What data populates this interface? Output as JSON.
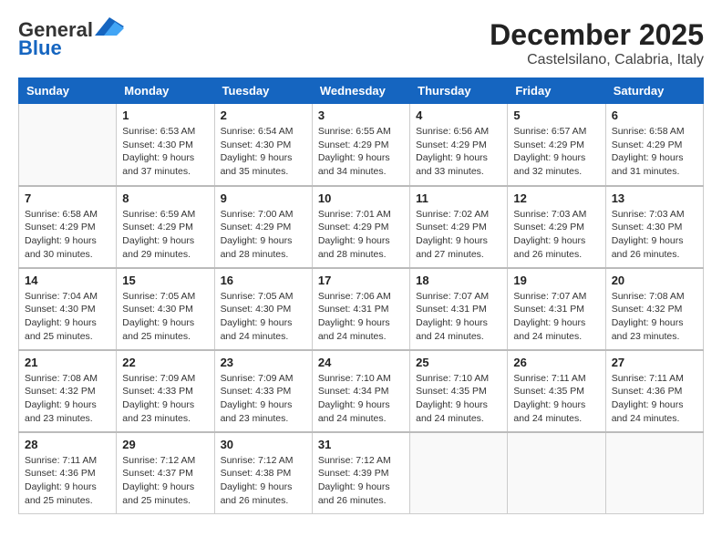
{
  "header": {
    "logo_general": "General",
    "logo_blue": "Blue",
    "title": "December 2025",
    "subtitle": "Castelsilano, Calabria, Italy"
  },
  "days_of_week": [
    "Sunday",
    "Monday",
    "Tuesday",
    "Wednesday",
    "Thursday",
    "Friday",
    "Saturday"
  ],
  "weeks": [
    [
      {
        "day": "",
        "info": ""
      },
      {
        "day": "1",
        "info": "Sunrise: 6:53 AM\nSunset: 4:30 PM\nDaylight: 9 hours\nand 37 minutes."
      },
      {
        "day": "2",
        "info": "Sunrise: 6:54 AM\nSunset: 4:30 PM\nDaylight: 9 hours\nand 35 minutes."
      },
      {
        "day": "3",
        "info": "Sunrise: 6:55 AM\nSunset: 4:29 PM\nDaylight: 9 hours\nand 34 minutes."
      },
      {
        "day": "4",
        "info": "Sunrise: 6:56 AM\nSunset: 4:29 PM\nDaylight: 9 hours\nand 33 minutes."
      },
      {
        "day": "5",
        "info": "Sunrise: 6:57 AM\nSunset: 4:29 PM\nDaylight: 9 hours\nand 32 minutes."
      },
      {
        "day": "6",
        "info": "Sunrise: 6:58 AM\nSunset: 4:29 PM\nDaylight: 9 hours\nand 31 minutes."
      }
    ],
    [
      {
        "day": "7",
        "info": "Sunrise: 6:58 AM\nSunset: 4:29 PM\nDaylight: 9 hours\nand 30 minutes."
      },
      {
        "day": "8",
        "info": "Sunrise: 6:59 AM\nSunset: 4:29 PM\nDaylight: 9 hours\nand 29 minutes."
      },
      {
        "day": "9",
        "info": "Sunrise: 7:00 AM\nSunset: 4:29 PM\nDaylight: 9 hours\nand 28 minutes."
      },
      {
        "day": "10",
        "info": "Sunrise: 7:01 AM\nSunset: 4:29 PM\nDaylight: 9 hours\nand 28 minutes."
      },
      {
        "day": "11",
        "info": "Sunrise: 7:02 AM\nSunset: 4:29 PM\nDaylight: 9 hours\nand 27 minutes."
      },
      {
        "day": "12",
        "info": "Sunrise: 7:03 AM\nSunset: 4:29 PM\nDaylight: 9 hours\nand 26 minutes."
      },
      {
        "day": "13",
        "info": "Sunrise: 7:03 AM\nSunset: 4:30 PM\nDaylight: 9 hours\nand 26 minutes."
      }
    ],
    [
      {
        "day": "14",
        "info": "Sunrise: 7:04 AM\nSunset: 4:30 PM\nDaylight: 9 hours\nand 25 minutes."
      },
      {
        "day": "15",
        "info": "Sunrise: 7:05 AM\nSunset: 4:30 PM\nDaylight: 9 hours\nand 25 minutes."
      },
      {
        "day": "16",
        "info": "Sunrise: 7:05 AM\nSunset: 4:30 PM\nDaylight: 9 hours\nand 24 minutes."
      },
      {
        "day": "17",
        "info": "Sunrise: 7:06 AM\nSunset: 4:31 PM\nDaylight: 9 hours\nand 24 minutes."
      },
      {
        "day": "18",
        "info": "Sunrise: 7:07 AM\nSunset: 4:31 PM\nDaylight: 9 hours\nand 24 minutes."
      },
      {
        "day": "19",
        "info": "Sunrise: 7:07 AM\nSunset: 4:31 PM\nDaylight: 9 hours\nand 24 minutes."
      },
      {
        "day": "20",
        "info": "Sunrise: 7:08 AM\nSunset: 4:32 PM\nDaylight: 9 hours\nand 23 minutes."
      }
    ],
    [
      {
        "day": "21",
        "info": "Sunrise: 7:08 AM\nSunset: 4:32 PM\nDaylight: 9 hours\nand 23 minutes."
      },
      {
        "day": "22",
        "info": "Sunrise: 7:09 AM\nSunset: 4:33 PM\nDaylight: 9 hours\nand 23 minutes."
      },
      {
        "day": "23",
        "info": "Sunrise: 7:09 AM\nSunset: 4:33 PM\nDaylight: 9 hours\nand 23 minutes."
      },
      {
        "day": "24",
        "info": "Sunrise: 7:10 AM\nSunset: 4:34 PM\nDaylight: 9 hours\nand 24 minutes."
      },
      {
        "day": "25",
        "info": "Sunrise: 7:10 AM\nSunset: 4:35 PM\nDaylight: 9 hours\nand 24 minutes."
      },
      {
        "day": "26",
        "info": "Sunrise: 7:11 AM\nSunset: 4:35 PM\nDaylight: 9 hours\nand 24 minutes."
      },
      {
        "day": "27",
        "info": "Sunrise: 7:11 AM\nSunset: 4:36 PM\nDaylight: 9 hours\nand 24 minutes."
      }
    ],
    [
      {
        "day": "28",
        "info": "Sunrise: 7:11 AM\nSunset: 4:36 PM\nDaylight: 9 hours\nand 25 minutes."
      },
      {
        "day": "29",
        "info": "Sunrise: 7:12 AM\nSunset: 4:37 PM\nDaylight: 9 hours\nand 25 minutes."
      },
      {
        "day": "30",
        "info": "Sunrise: 7:12 AM\nSunset: 4:38 PM\nDaylight: 9 hours\nand 26 minutes."
      },
      {
        "day": "31",
        "info": "Sunrise: 7:12 AM\nSunset: 4:39 PM\nDaylight: 9 hours\nand 26 minutes."
      },
      {
        "day": "",
        "info": ""
      },
      {
        "day": "",
        "info": ""
      },
      {
        "day": "",
        "info": ""
      }
    ]
  ]
}
